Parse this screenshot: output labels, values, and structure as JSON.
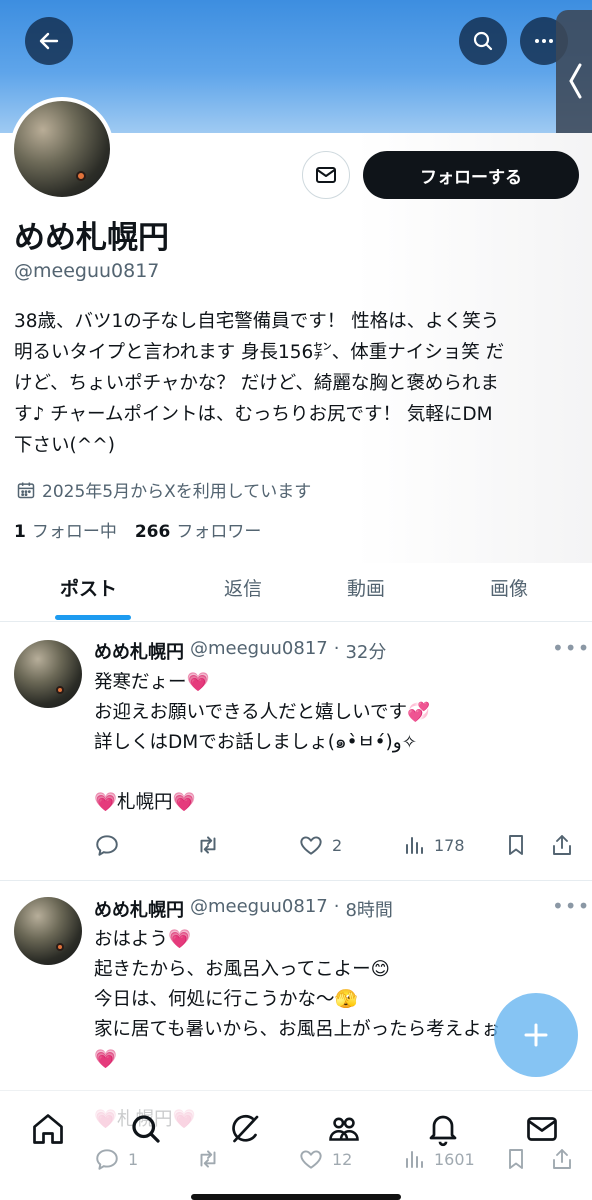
{
  "profile": {
    "display_name": "めめ札幌円",
    "handle": "@meeguu0817",
    "bio": "38歳、バツ1の子なし自宅警備員です！ 性格は、よく笑う\n明るいタイプと言われます 身長156㌢、体重ナイショ笑 だ\nけど、ちょいポチャかな？ だけど、綺麗な胸と褒められま\nす♪ チャームポイントは、むっちりお尻です！ 気軽にDM\n下さい(^^)",
    "joined": "2025年5月からXを利用しています",
    "following_count": "1",
    "following_label": "フォロー中",
    "followers_count": "266",
    "followers_label": "フォロワー",
    "follow_button": "フォローする"
  },
  "tabs": [
    "ポスト",
    "返信",
    "動画",
    "画像"
  ],
  "tweets": [
    {
      "name": "めめ札幌円",
      "handle": "@meeguu0817",
      "sep": "·",
      "time": "32分",
      "body": "発寒だょー💗\nお迎えお願いできる人だと嬉しいです💞\n詳しくはDMでお話しましょ(๑•̀ㅂ•́)و✧\n\n💗札幌円💗",
      "replies": "",
      "retweets": "",
      "likes": "2",
      "views": "178"
    },
    {
      "name": "めめ札幌円",
      "handle": "@meeguu0817",
      "sep": "·",
      "time": "8時間",
      "body": "おはよう💗\n起きたから、お風呂入ってこよー😊\n今日は、何処に行こうかな〜🫣\n家に居ても暑いから、お風呂上がったら考えよぉ\n💗\n\n💗札幌円💗",
      "replies": "1",
      "retweets": "",
      "likes": "12",
      "views": "1601"
    }
  ],
  "colors": {
    "accent": "#1d9bf0",
    "banner": "#4a98e5",
    "text": "#0f1419",
    "muted": "#536471"
  },
  "icons": [
    "back-arrow-icon",
    "search-icon",
    "more-dots-icon",
    "chevron-left-icon",
    "mail-icon",
    "calendar-icon",
    "reply-icon",
    "retweet-icon",
    "like-icon",
    "views-icon",
    "bookmark-icon",
    "share-icon",
    "plus-icon",
    "home-icon",
    "grok-icon",
    "communities-icon",
    "notifications-icon"
  ]
}
